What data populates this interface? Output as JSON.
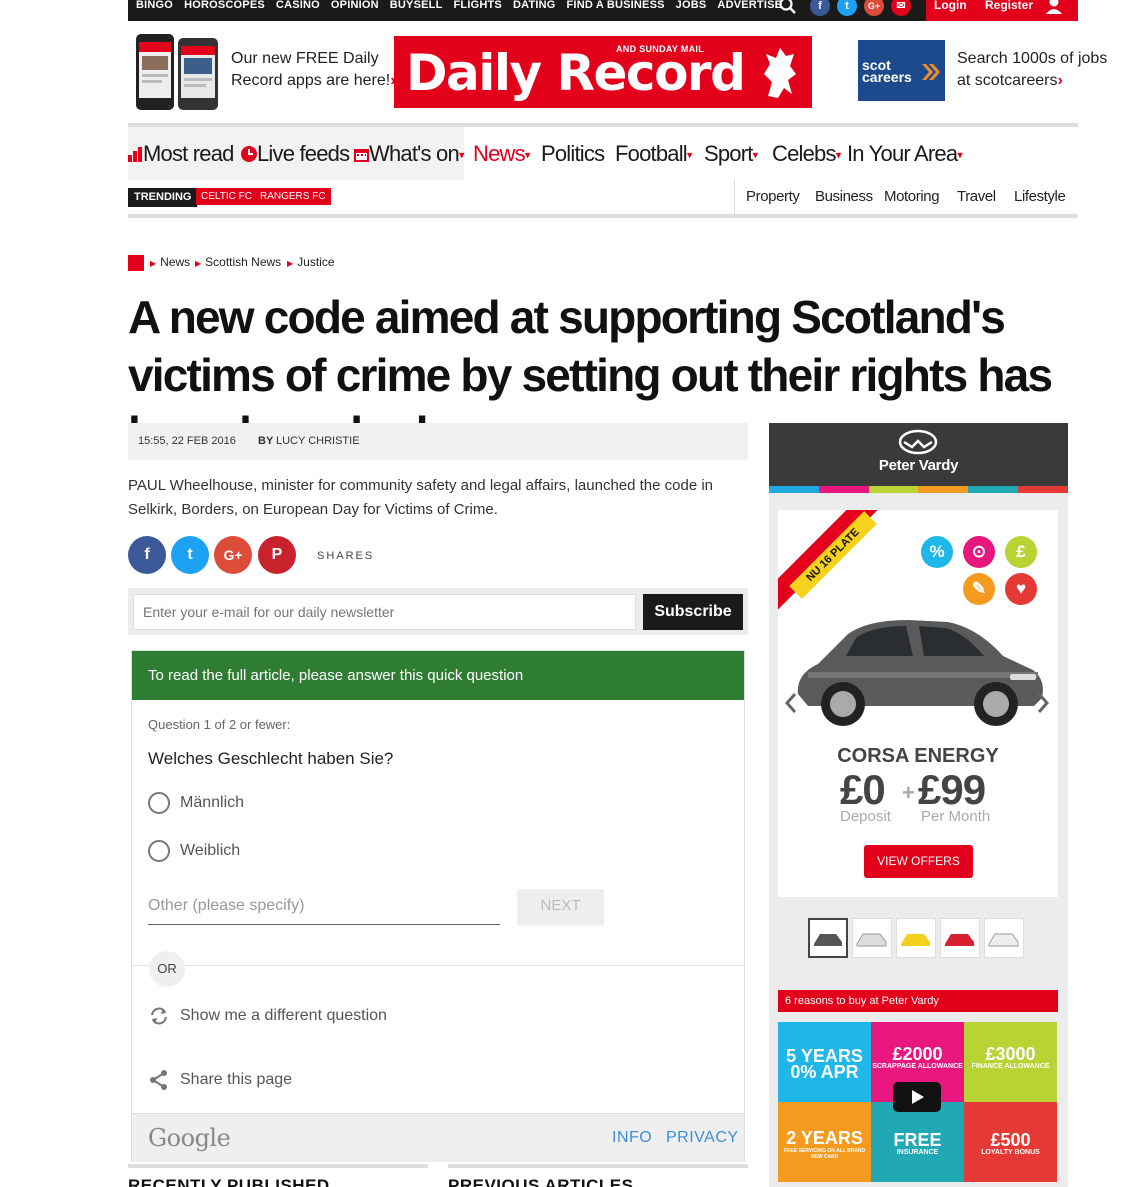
{
  "topbar": {
    "links": [
      "BINGO",
      "HOROSCOPES",
      "CASINO",
      "OPINION",
      "BUYSELL",
      "FLIGHTS",
      "DATING",
      "FIND A BUSINESS",
      "JOBS",
      "ADVERTISE"
    ],
    "login": "Login",
    "register": "Register"
  },
  "header": {
    "apps_line1": "Our new FREE Daily",
    "apps_line2": "Record apps are here!",
    "logo_sub": "AND SUNDAY MAIL",
    "logo_main": "Daily Record",
    "scot_logo_1": "scot",
    "scot_logo_2": "careers",
    "jobs_line1": "Search 1000s of jobs",
    "jobs_line2": "at scotcareers"
  },
  "nav": {
    "most_read": "Most read",
    "live_feeds": "Live feeds",
    "whats_on": "What's on",
    "news": "News",
    "politics": "Politics",
    "football": "Football",
    "sport": "Sport",
    "celebs": "Celebs",
    "in_your_area": "In Your Area"
  },
  "subnav": {
    "trending": "TRENDING",
    "tags": [
      "CELTIC FC",
      "RANGERS FC"
    ],
    "links": [
      "Property",
      "Business",
      "Motoring",
      "Travel",
      "Lifestyle"
    ]
  },
  "breadcrumb": [
    "News",
    "Scottish News",
    "Justice"
  ],
  "article": {
    "headline": "A new code aimed at supporting Scotland's victims of crime by setting out their rights has been launched",
    "date": "15:55, 22 FEB 2016",
    "by_label": "BY",
    "author": "LUCY CHRISTIE",
    "lead": "PAUL Wheelhouse, minister for community safety and legal affairs, launched the code in Selkirk, Borders, on European Day for Victims of Crime.",
    "shares_label": "SHARES"
  },
  "newsletter": {
    "placeholder": "Enter your e-mail for our daily newsletter",
    "button": "Subscribe"
  },
  "survey": {
    "header": "To read the full article, please answer this quick question",
    "question_num": "Question 1 of 2 or fewer:",
    "question": "Welches Geschlecht haben Sie?",
    "options": [
      "Männlich",
      "Weiblich"
    ],
    "other_placeholder": "Other (please specify)",
    "next": "NEXT",
    "or": "OR",
    "different": "Show me a different question",
    "share": "Share this page",
    "google": "Google",
    "info": "INFO",
    "privacy": "PRIVACY"
  },
  "sections": {
    "recent": "RECENTLY PUBLISHED",
    "previous": "PREVIOUS ARTICLES"
  },
  "ad": {
    "brand": "Peter Vardy",
    "ribbon": "NU 16 PLATE",
    "icons": [
      "%",
      "£"
    ],
    "model": "CORSA ENERGY",
    "price1": "£0",
    "price1_sub": "Deposit",
    "plus": "+",
    "price2": "£99",
    "price2_sub": "Per Month",
    "cta": "VIEW OFFERS",
    "reasons_title": "6 reasons to buy at Peter Vardy",
    "tiles": [
      {
        "big": "5 YEARS\n0% APR",
        "small": "",
        "color": "#1fb6e8"
      },
      {
        "big": "£2000",
        "small": "SCRAPPAGE ALLOWANCE",
        "color": "#e8177f"
      },
      {
        "big": "£3000",
        "small": "FINANCE ALLOWANCE",
        "color": "#b7d334"
      },
      {
        "big": "2 YEARS",
        "small": "FREE SERVICING ON ALL BRAND NEW CARS",
        "color": "#f39a1f"
      },
      {
        "big": "FREE",
        "small": "INSURANCE",
        "color": "#20a9b5"
      },
      {
        "big": "£500",
        "small": "LOYALTY BONUS",
        "color": "#e53935"
      }
    ]
  },
  "colors": {
    "brand_red": "#e2001a",
    "survey_green": "#2e7d32",
    "link_blue": "#3b8edc"
  }
}
